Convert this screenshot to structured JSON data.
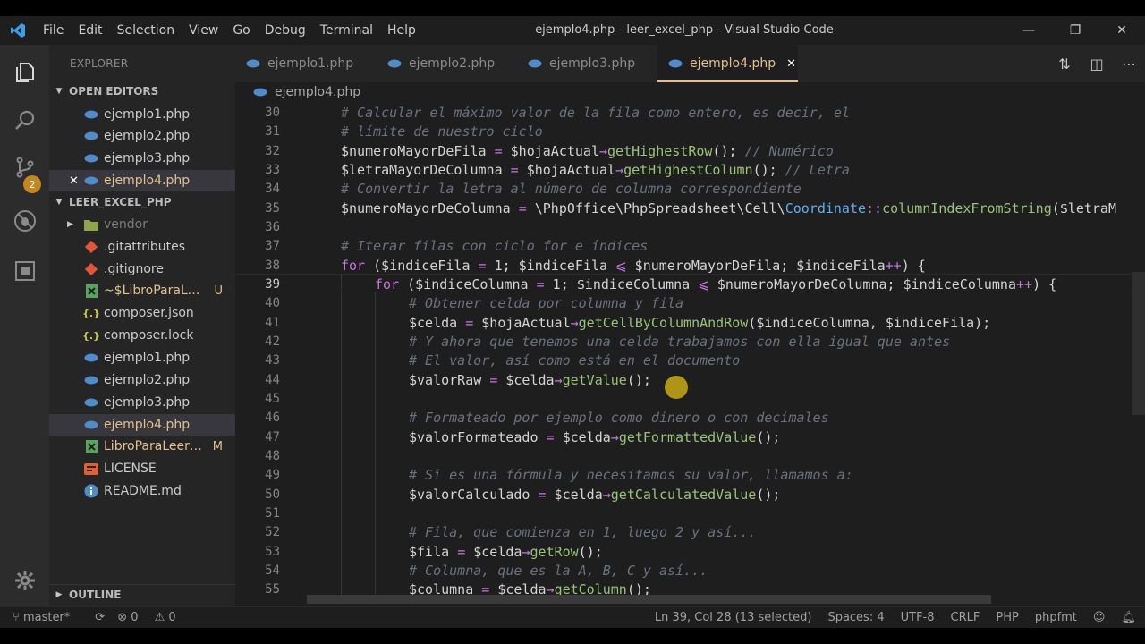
{
  "window": {
    "title": "ejemplo4.php - leer_excel_php - Visual Studio Code",
    "menu": [
      "File",
      "Edit",
      "Selection",
      "View",
      "Go",
      "Debug",
      "Terminal",
      "Help"
    ],
    "controls": [
      "—",
      "❐",
      "✕"
    ]
  },
  "activity": {
    "scm_badge": "2",
    "icons": [
      "files-icon",
      "search-icon",
      "source-control-icon",
      "debug-icon",
      "extensions-icon",
      "settings-gear-icon"
    ]
  },
  "sidebar": {
    "title": "EXPLORER",
    "open_editors_label": "OPEN EDITORS",
    "open_editors": [
      "ejemplo1.php",
      "ejemplo2.php",
      "ejemplo3.php",
      "ejemplo4.php"
    ],
    "project_label": "LEER_EXCEL_PHP",
    "files": [
      {
        "name": "vendor",
        "icon": "folder",
        "status": ""
      },
      {
        "name": ".gitattributes",
        "icon": "git",
        "status": ""
      },
      {
        "name": ".gitignore",
        "icon": "git",
        "status": ""
      },
      {
        "name": "~$LibroParaLee...",
        "icon": "excel",
        "status": "U"
      },
      {
        "name": "composer.json",
        "icon": "json",
        "status": ""
      },
      {
        "name": "composer.lock",
        "icon": "json",
        "status": ""
      },
      {
        "name": "ejemplo1.php",
        "icon": "php",
        "status": ""
      },
      {
        "name": "ejemplo2.php",
        "icon": "php",
        "status": ""
      },
      {
        "name": "ejemplo3.php",
        "icon": "php",
        "status": ""
      },
      {
        "name": "ejemplo4.php",
        "icon": "php",
        "status": ""
      },
      {
        "name": "LibroParaLeerC...",
        "icon": "excel",
        "status": "M"
      },
      {
        "name": "LICENSE",
        "icon": "license",
        "status": ""
      },
      {
        "name": "README.md",
        "icon": "info",
        "status": ""
      }
    ],
    "outline_label": "OUTLINE"
  },
  "tabs": [
    "ejemplo1.php",
    "ejemplo2.php",
    "ejemplo3.php",
    "ejemplo4.php"
  ],
  "active_tab_close": "✕",
  "breadcrumb": "ejemplo4.php",
  "editor": {
    "line_numbers": [
      "30",
      "31",
      "32",
      "33",
      "34",
      "35",
      "36",
      "37",
      "38",
      "39",
      "40",
      "41",
      "42",
      "43",
      "44",
      "45",
      "46",
      "47",
      "48",
      "49",
      "50",
      "51",
      "52",
      "53",
      "54",
      "55"
    ],
    "lines": [
      "# Calcular el máximo valor de la fila como entero, es decir, el",
      "# límite de nuestro ciclo",
      "$numeroMayorDeFila = $hojaActual→getHighestRow(); // Numérico",
      "$letraMayorDeColumna = $hojaActual→getHighestColumn(); // Letra",
      "# Convertir la letra al número de columna correspondiente",
      "$numeroMayorDeColumna = \\PhpOffice\\PhpSpreadsheet\\Cell\\Coordinate::columnIndexFromString($letraM",
      "",
      "# Iterar filas con ciclo for e índices",
      "for ($indiceFila = 1; $indiceFila ⩽ $numeroMayorDeFila; $indiceFila++) {",
      "for ($indiceColumna = 1; $indiceColumna ⩽ $numeroMayorDeColumna; $indiceColumna++) {",
      "# Obtener celda por columna y fila",
      "$celda = $hojaActual→getCellByColumnAndRow($indiceColumna, $indiceFila);",
      "# Y ahora que tenemos una celda trabajamos con ella igual que antes",
      "# El valor, así como está en el documento",
      "$valorRaw = $celda→getValue();",
      "",
      "# Formateado por ejemplo como dinero o con decimales",
      "$valorFormateado = $celda→getFormattedValue();",
      "",
      "# Si es una fórmula y necesitamos su valor, llamamos a:",
      "$valorCalculado = $celda→getCalculatedValue();",
      "",
      "# Fila, que comienza en 1, luego 2 y así...",
      "$fila = $celda→getRow();",
      "# Columna, que es la A, B, C y así...",
      "$columna = $celda→getColumn();"
    ]
  },
  "status": {
    "branch": "master*",
    "errors": "0",
    "warnings": "0",
    "position": "Ln 39, Col 28 (13 selected)",
    "spaces": "Spaces: 4",
    "encoding": "UTF-8",
    "eol": "CRLF",
    "language": "PHP",
    "formatter": "phpfmt"
  },
  "colors": {
    "accent_tab": "#e2c08d",
    "comment": "#6a7280",
    "function": "#98c379",
    "keyword": "#c678dd",
    "number": "#d19a66",
    "badge": "#c4861e"
  }
}
